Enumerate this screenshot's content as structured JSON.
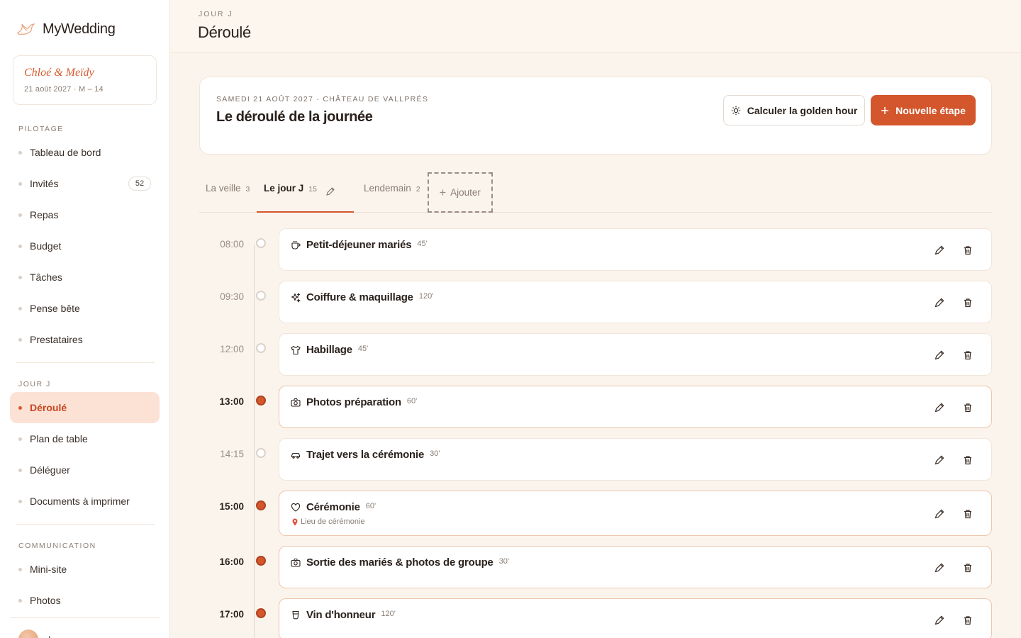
{
  "brand": {
    "name": "MyWedding"
  },
  "couple": {
    "names": "Chloé & Meïdy",
    "date_line": "21 août 2027 · M – 14"
  },
  "sidebar": {
    "sections": [
      {
        "label": "PILOTAGE"
      },
      {
        "label": "JOUR J"
      },
      {
        "label": "COMMUNICATION"
      }
    ],
    "items": [
      {
        "label": "Tableau de bord"
      },
      {
        "label": "Invités",
        "badge": "52"
      },
      {
        "label": "Repas"
      },
      {
        "label": "Budget"
      },
      {
        "label": "Tâches"
      },
      {
        "label": "Pense bête"
      },
      {
        "label": "Prestataires"
      },
      {
        "label": "Déroulé",
        "active": true
      },
      {
        "label": "Plan de table"
      },
      {
        "label": "Déléguer"
      },
      {
        "label": "Documents à imprimer"
      },
      {
        "label": "Mini-site"
      },
      {
        "label": "Photos"
      }
    ],
    "user": {
      "name": "dem"
    }
  },
  "header": {
    "eyebrow": "JOUR J",
    "title": "Déroulé"
  },
  "day_card": {
    "meta": "SAMEDI 21 AOÛT 2027 · CHÂTEAU DE VALLPRÉS",
    "title": "Le déroulé de la journée",
    "golden_hour_button": "Calculer la golden hour",
    "new_step_button": "Nouvelle étape"
  },
  "tabs": [
    {
      "label": "La veille",
      "count": "3"
    },
    {
      "label": "Le jour J",
      "count": "15",
      "active": true
    },
    {
      "label": "Lendemain",
      "count": "2"
    }
  ],
  "add_tab_label": "Ajouter",
  "steps": [
    {
      "time": "08:00",
      "title": "Petit-déjeuner mariés",
      "duration": "45'",
      "icon": "coffee-icon",
      "key": false
    },
    {
      "time": "09:30",
      "title": "Coiffure & maquillage",
      "duration": "120'",
      "icon": "sparkles-icon",
      "key": false
    },
    {
      "time": "12:00",
      "title": "Habillage",
      "duration": "45'",
      "icon": "shirt-icon",
      "key": false
    },
    {
      "time": "13:00",
      "title": "Photos préparation",
      "duration": "60'",
      "icon": "camera-icon",
      "key": true
    },
    {
      "time": "14:15",
      "title": "Trajet vers la cérémonie",
      "duration": "30'",
      "icon": "car-icon",
      "key": false
    },
    {
      "time": "15:00",
      "title": "Cérémonie",
      "duration": "60'",
      "icon": "heart-icon",
      "key": true,
      "location": "Lieu de cérémonie"
    },
    {
      "time": "16:00",
      "title": "Sortie des mariés & photos de groupe",
      "duration": "30'",
      "icon": "camera-icon",
      "key": true
    },
    {
      "time": "17:00",
      "title": "Vin d'honneur",
      "duration": "120'",
      "icon": "glass-icon",
      "key": true
    }
  ],
  "colors": {
    "accent": "#d4562c",
    "active_bg": "#fbe2d4",
    "page_bg": "#fbf4ec"
  }
}
